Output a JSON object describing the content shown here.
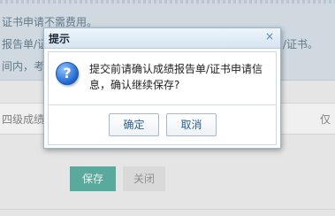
{
  "background": {
    "notice_lines": [
      "证书申请不需费用。",
      "报告单/证",
      "间内，考",
      "/证书。"
    ],
    "level_label": "四级成绩",
    "level_tail": "仅",
    "buttons": {
      "save": "保存",
      "close": "关闭"
    }
  },
  "dialog": {
    "title": "提示",
    "close_glyph": "×",
    "icon": "question-icon",
    "icon_glyph": "?",
    "message": "提交前请确认成绩报告单/证书申请信息，确认继续保存?",
    "buttons": {
      "ok": "确定",
      "cancel": "取消"
    }
  }
}
